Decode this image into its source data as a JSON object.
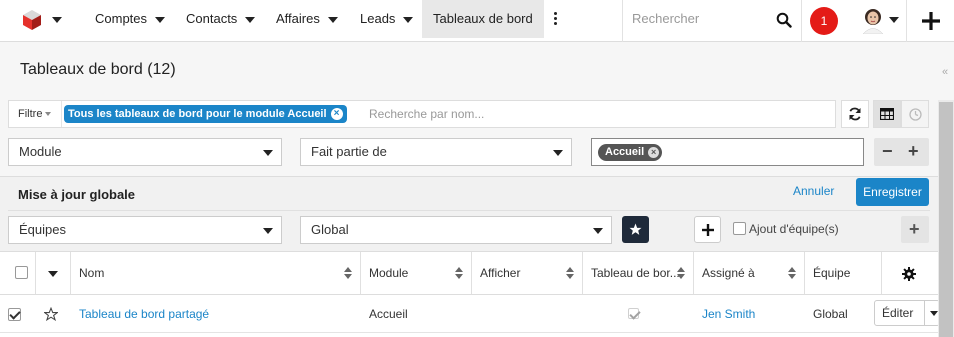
{
  "nav": {
    "tabs": [
      {
        "label": "Comptes"
      },
      {
        "label": "Contacts"
      },
      {
        "label": "Affaires"
      },
      {
        "label": "Leads"
      },
      {
        "label": "Tableaux de bord"
      }
    ],
    "search_placeholder": "Rechercher",
    "notification_count": "1",
    "icons": {
      "logo": "cube-logo-icon",
      "search": "search-icon",
      "more": "kebab-icon",
      "plus": "plus-icon"
    }
  },
  "header": {
    "title": "Tableaux de bord (12)"
  },
  "filter": {
    "button_label": "Filtre",
    "active_filter": "Tous les tableaux de bord pour le module Accueil",
    "name_search_placeholder": "Recherche par nom..."
  },
  "field_filter": {
    "field": "Module",
    "operator": "Fait partie de",
    "value_tag": "Accueil"
  },
  "mass_update": {
    "title": "Mise à jour globale",
    "cancel_label": "Annuler",
    "save_label": "Enregistrer",
    "field": "Équipes",
    "team_value": "Global",
    "append_team_label": "Ajout d'équipe(s)"
  },
  "table": {
    "columns": [
      "Nom",
      "Module",
      "Afficher",
      "Tableau de bor...",
      "Assigné à",
      "Équipe"
    ],
    "rows": [
      {
        "name": "Tableau de bord partagé",
        "module": "Accueil",
        "afficher": "",
        "dashboard_checked": true,
        "assigned": "Jen Smith",
        "team": "Global",
        "edit_label": "Éditer",
        "selected": true
      }
    ]
  },
  "colors": {
    "accent": "#1b85c8",
    "badge": "#e41b17",
    "dark_button": "#1f2a3a"
  }
}
